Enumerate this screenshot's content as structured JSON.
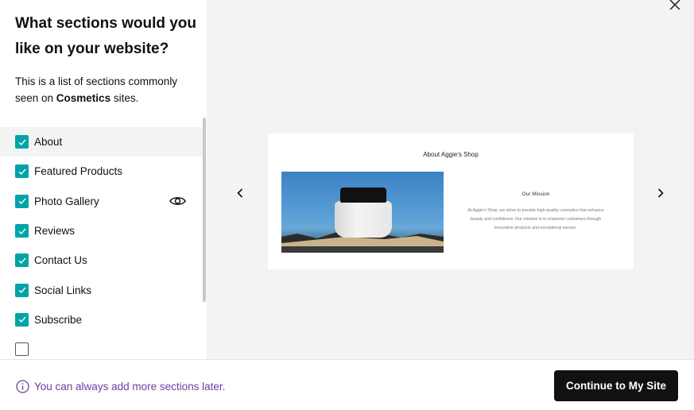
{
  "panel": {
    "title": "What sections would you like on your website?",
    "subtitle_prefix": "This is a list of sections commonly seen on ",
    "subtitle_bold": "Cosmetics",
    "subtitle_suffix": " sites."
  },
  "sections": [
    {
      "label": "About",
      "checked": true
    },
    {
      "label": "Featured Products",
      "checked": true
    },
    {
      "label": "Photo Gallery",
      "checked": true
    },
    {
      "label": "Reviews",
      "checked": true
    },
    {
      "label": "Contact Us",
      "checked": true
    },
    {
      "label": "Social Links",
      "checked": true
    },
    {
      "label": "Subscribe",
      "checked": true
    }
  ],
  "preview": {
    "heading": "About Aggie's Shop",
    "mission_title": "Our Mission",
    "mission_text": "At Aggie's Shop, we strive to provide high-quality cosmetics that enhance beauty and confidence. Our mission is to empower customers through innovative products and exceptional service."
  },
  "footer": {
    "info_text": "You can always add more sections later.",
    "continue_label": "Continue to My Site"
  },
  "colors": {
    "checkbox": "#00a4a6",
    "info_text": "#6b3fa0",
    "primary_button": "#111111"
  },
  "icons": {
    "close": "close-icon",
    "prev": "chevron-left-icon",
    "next": "chevron-right-icon",
    "preview_toggle": "eye-icon",
    "info": "info-icon",
    "check": "check-icon"
  }
}
